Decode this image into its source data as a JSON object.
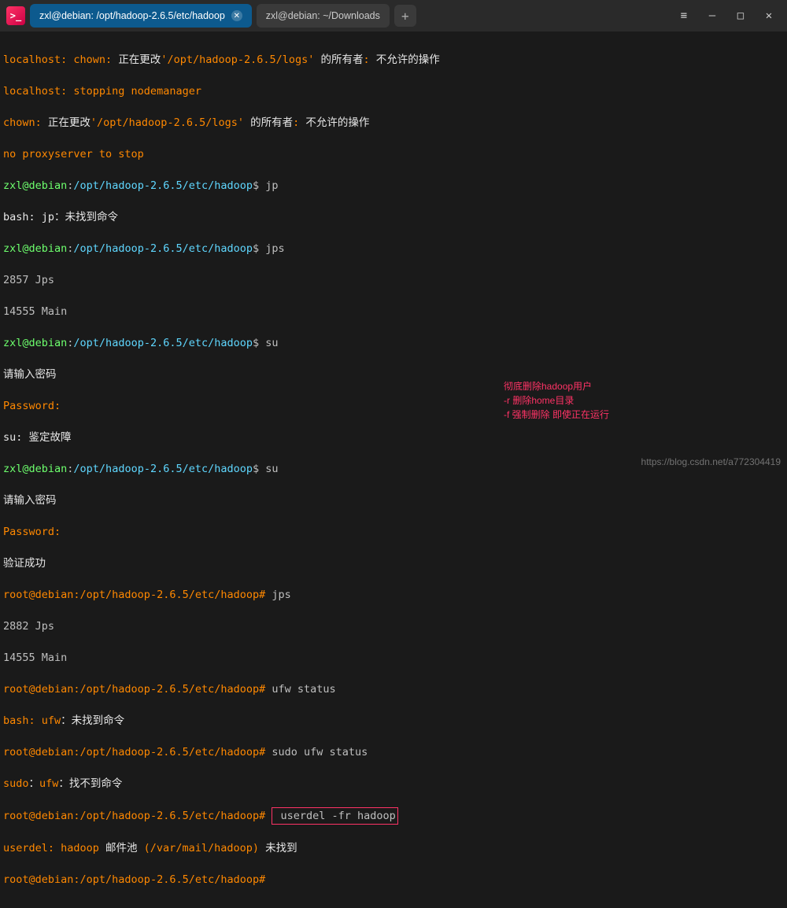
{
  "titlebar": {
    "tabs": [
      {
        "label": "zxl@debian: /opt/hadoop-2.6.5/etc/hadoop",
        "active": true
      },
      {
        "label": "zxl@debian: ~/Downloads",
        "active": false
      }
    ],
    "new_tab_glyph": "+",
    "menu_glyph": "≡",
    "minimize_glyph": "—",
    "maximize_glyph": "□",
    "close_glyph": "✕"
  },
  "prompt": {
    "user": "zxl@debian",
    "root": "root@debian",
    "path": "/opt/hadoop-2.6.5/etc/hadoop",
    "user_sep": ":",
    "user_end": "$",
    "root_end": "#"
  },
  "lines": {
    "l1a": "localhost: chown: ",
    "l1b": "正在更改",
    "l1c": "'/opt/hadoop-2.6.5/logs' ",
    "l1d": "的所有者",
    "l1e": ": ",
    "l1f": "不允许的操作",
    "l2": "localhost: stopping nodemanager",
    "l3a": "chown: ",
    "l3b": "正在更改",
    "l3c": "'/opt/hadoop-2.6.5/logs' ",
    "l3d": "的所有者",
    "l3e": ": ",
    "l3f": "不允许的操作",
    "l4": "no proxyserver to stop",
    "cmd_jp": " jp",
    "l6": "bash: jp：未找到命令",
    "cmd_jps": " jps",
    "l8": "2857 Jps",
    "l9": "14555 Main",
    "cmd_su": " su",
    "l11": "请输入密码",
    "l12": "Password:",
    "l13": "su: 鉴定故障",
    "l15": "请输入密码",
    "l16": "Password:",
    "l17": "验证成功",
    "cmd_jps2": " jps",
    "l19": "2882 Jps",
    "l20": "14555 Main",
    "cmd_ufw": " ufw status",
    "l22a": "bash: ufw",
    "l22b": "：未找到命令",
    "cmd_sudo_ufw": " sudo ufw status",
    "l24a": "sudo",
    "l24b": "：",
    "l24c": "ufw",
    "l24d": "：找不到命令",
    "cmd_userdel": " userdel -fr hadoop",
    "l26a": "userdel: hadoop ",
    "l26b": "邮件池",
    "l26c": " (/var/mail/hadoop) ",
    "l26d": "未找到",
    "root_path": ":/opt/hadoop-2.6.5/etc/hadoop# "
  },
  "annotation": {
    "a1": "彻底删除hadoop用户",
    "a2": "-r 删除home目录",
    "a3": "-f 强制删除 即使正在运行"
  },
  "watermark": "https://blog.csdn.net/a772304419"
}
